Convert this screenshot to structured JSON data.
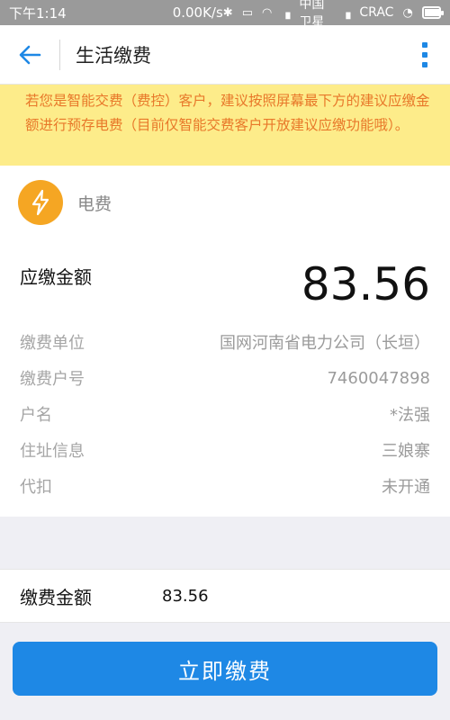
{
  "status_bar": {
    "time": "下午1:14",
    "speed": "0.00K/s",
    "carrier1": "中国卫星",
    "carrier2": "CRAC",
    "icons": [
      "bluetooth-icon",
      "vibrate-icon",
      "wifi-icon",
      "signal-icon",
      "signal-icon",
      "rotation-lock-icon",
      "battery-icon"
    ]
  },
  "header": {
    "title": "生活缴费"
  },
  "notice": {
    "text": "若您是智能交费（费控）客户，建议按照屏幕最下方的建议应缴金额进行预存电费（目前仅智能交费客户开放建议应缴功能哦）。"
  },
  "bill": {
    "type_label": "电费",
    "type_icon": "lightning-bolt-icon",
    "type_color": "#f5a623",
    "due_label": "应缴金额",
    "due_amount": "83.56",
    "rows": [
      {
        "label": "缴费单位",
        "value": "国网河南省电力公司（长垣）"
      },
      {
        "label": "缴费户号",
        "value": "7460047898"
      },
      {
        "label": "户名",
        "value": "*法强"
      },
      {
        "label": "住址信息",
        "value": "三娘寨"
      },
      {
        "label": "代扣",
        "value": "未开通"
      }
    ]
  },
  "payment": {
    "label": "缴费金额",
    "amount": "83.56",
    "button_label": "立即缴费",
    "accent_color": "#1e88e5"
  }
}
